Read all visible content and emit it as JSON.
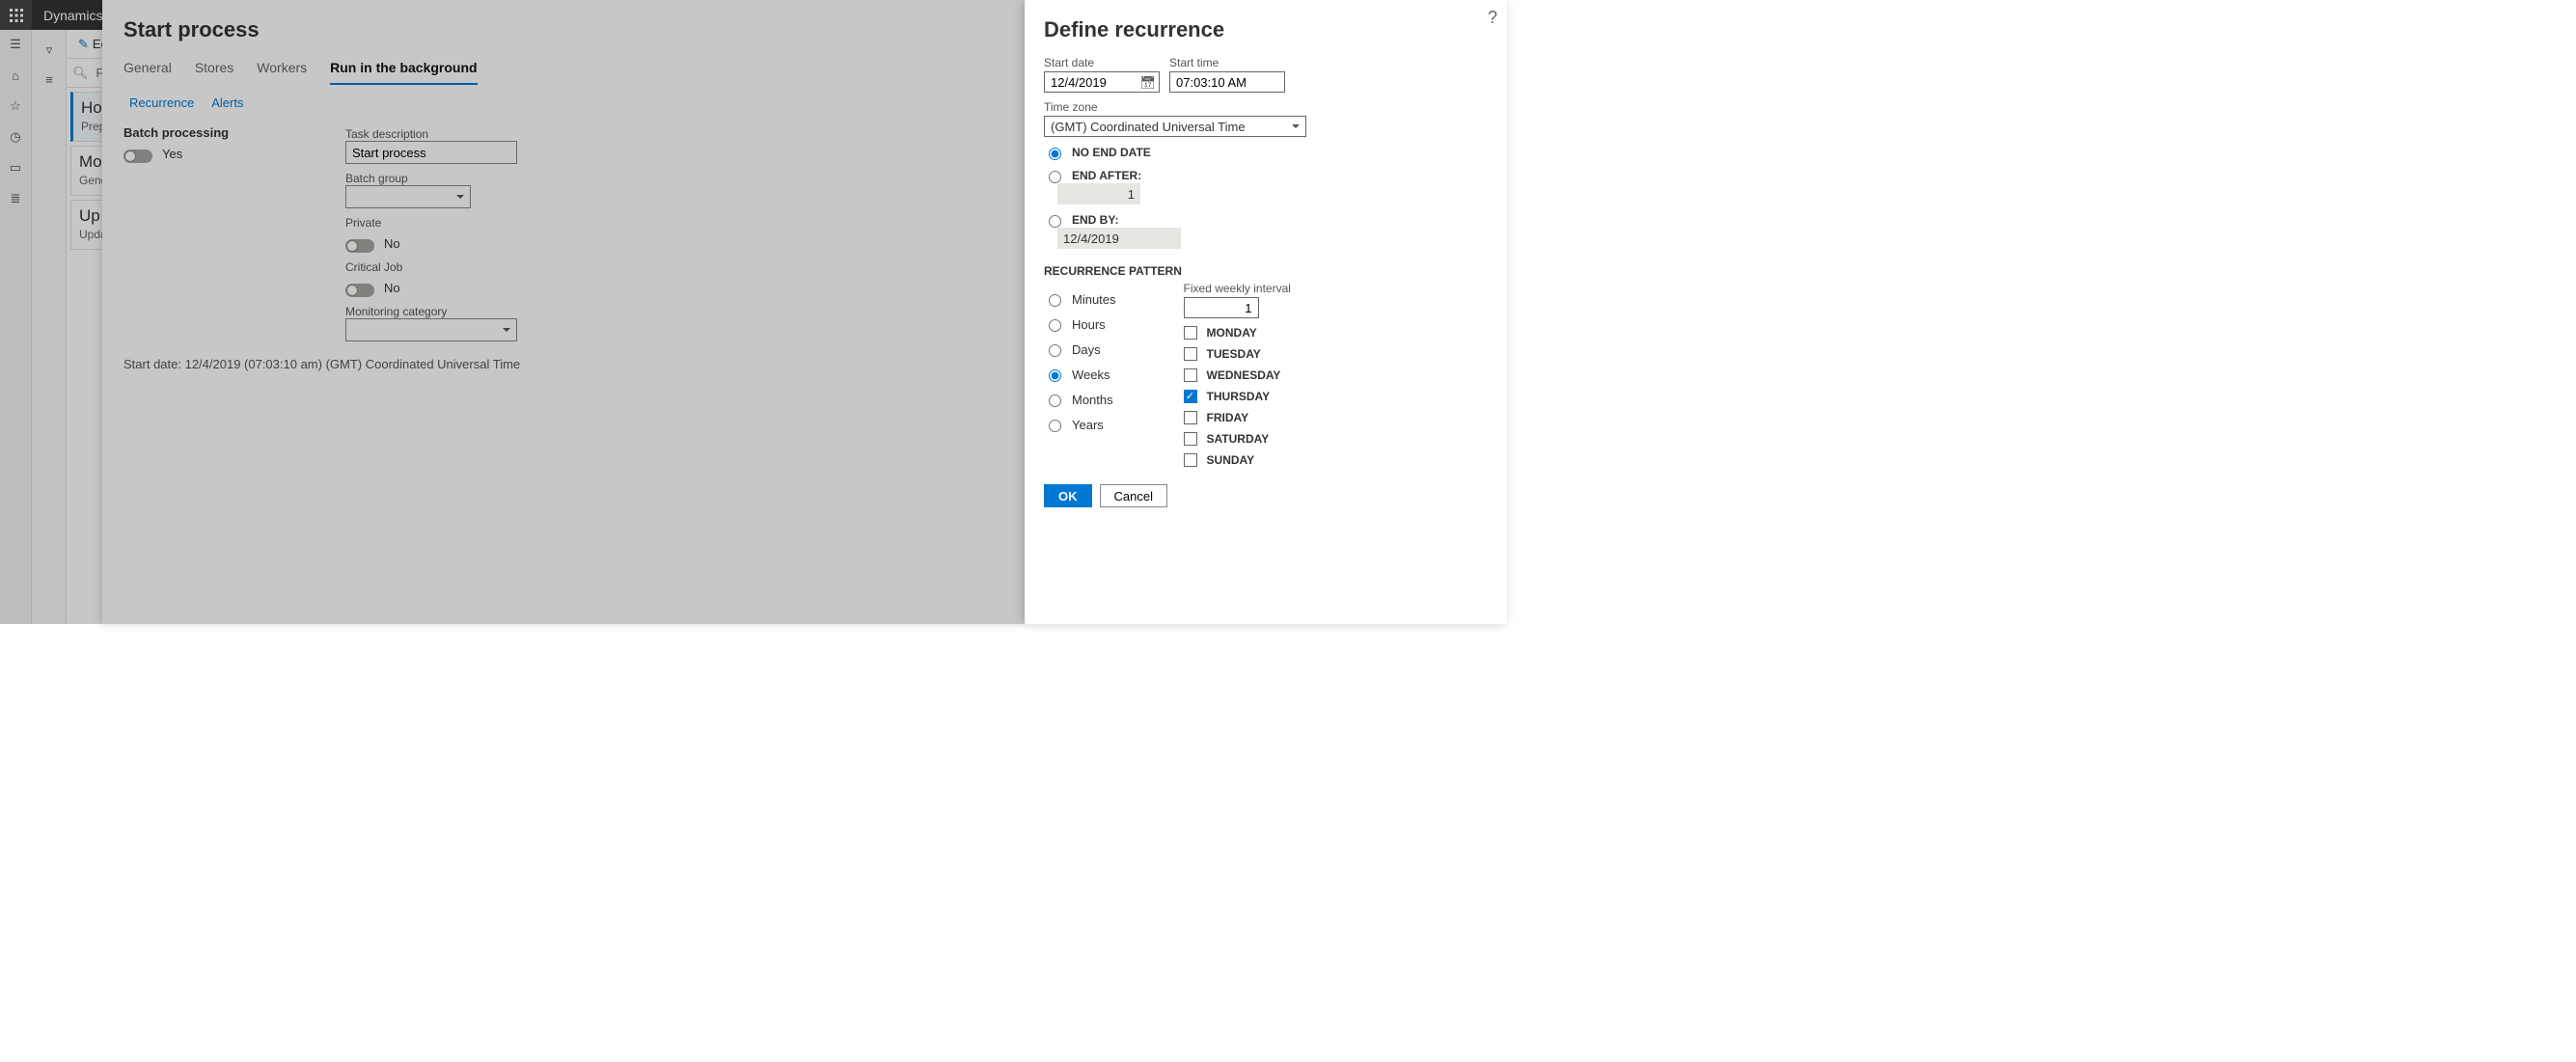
{
  "titlebar": {
    "brand": "Dynamics"
  },
  "toolbar": {
    "edit": "Edit"
  },
  "filter": {
    "placeholder": "Fil"
  },
  "list": {
    "items": [
      {
        "title": "Ho",
        "sub": "Prep"
      },
      {
        "title": "Mo",
        "sub": "Gene"
      },
      {
        "title": "Up",
        "sub": "Upda"
      }
    ]
  },
  "dialog1": {
    "title": "Start process",
    "tabs": {
      "general": "General",
      "stores": "Stores",
      "workers": "Workers",
      "runbg": "Run in the background"
    },
    "subtabs": {
      "recurrence": "Recurrence",
      "alerts": "Alerts"
    },
    "batch_processing_label": "Batch processing",
    "batch_processing_value": "Yes",
    "task_desc_label": "Task description",
    "task_desc_value": "Start process",
    "batch_group_label": "Batch group",
    "private_label": "Private",
    "private_value": "No",
    "critical_label": "Critical Job",
    "critical_value": "No",
    "monitoring_label": "Monitoring category",
    "footer": "Start date: 12/4/2019 (07:03:10 am) (GMT) Coordinated Universal Time"
  },
  "dialog2": {
    "title": "Define recurrence",
    "start_date_label": "Start date",
    "start_date_value": "12/4/2019",
    "start_time_label": "Start time",
    "start_time_value": "07:03:10 AM",
    "tz_label": "Time zone",
    "tz_value": "(GMT) Coordinated Universal Time",
    "no_end": "NO END DATE",
    "end_after": "END AFTER:",
    "end_after_value": "1",
    "end_by": "END BY:",
    "end_by_value": "12/4/2019",
    "pattern_label": "RECURRENCE PATTERN",
    "units": {
      "minutes": "Minutes",
      "hours": "Hours",
      "days": "Days",
      "weeks": "Weeks",
      "months": "Months",
      "years": "Years"
    },
    "interval_label": "Fixed weekly interval",
    "interval_value": "1",
    "days": {
      "mon": "MONDAY",
      "tue": "TUESDAY",
      "wed": "WEDNESDAY",
      "thu": "THURSDAY",
      "fri": "FRIDAY",
      "sat": "SATURDAY",
      "sun": "SUNDAY"
    },
    "ok": "OK",
    "cancel": "Cancel"
  }
}
